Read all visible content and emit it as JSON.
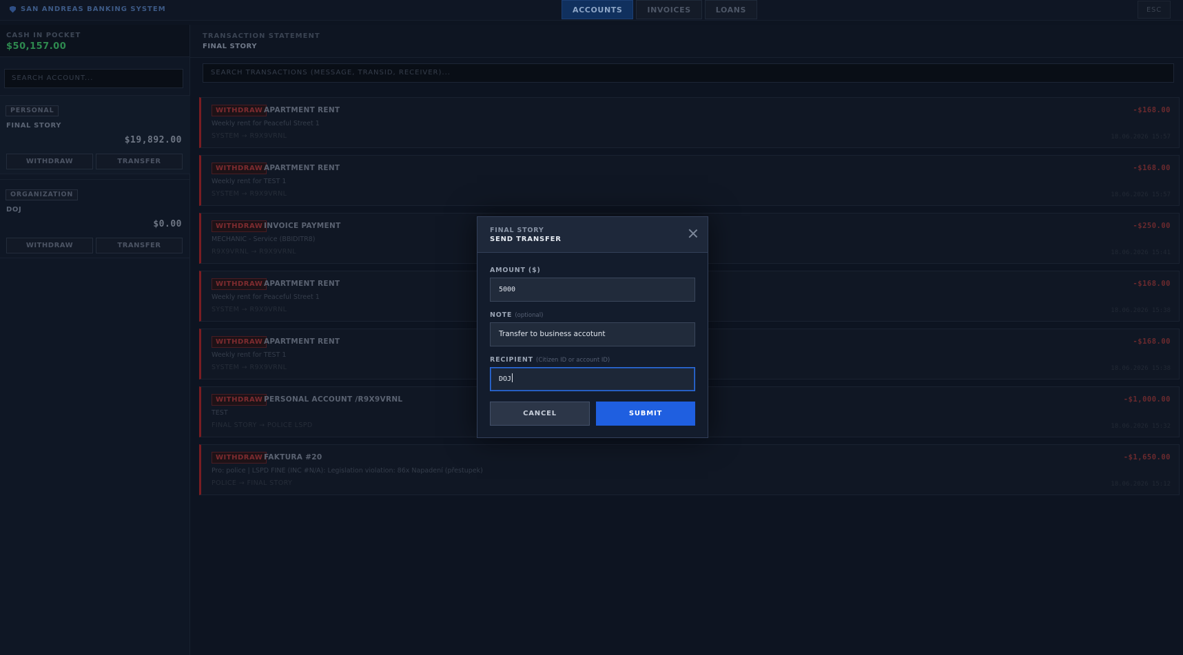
{
  "app": {
    "title": "SAN ANDREAS BANKING SYSTEM"
  },
  "nav": {
    "tabs": [
      {
        "label": "ACCOUNTS",
        "active": true
      },
      {
        "label": "INVOICES",
        "active": false
      },
      {
        "label": "LOANS",
        "active": false
      }
    ],
    "esc_label": "ESC"
  },
  "sidebar": {
    "cash_label": "CASH IN POCKET",
    "cash_value": "$50,157.00",
    "search_placeholder": "SEARCH ACCOUNT...",
    "accounts": [
      {
        "type": "PERSONAL",
        "name": "FINAL STORY",
        "balance": "$19,892.00",
        "withdraw_label": "WITHDRAW",
        "transfer_label": "TRANSFER"
      },
      {
        "type": "ORGANIZATION",
        "name": "DOJ",
        "balance": "$0.00",
        "withdraw_label": "WITHDRAW",
        "transfer_label": "TRANSFER"
      }
    ]
  },
  "statement": {
    "label": "TRANSACTION STATEMENT",
    "account_name": "FINAL STORY",
    "search_placeholder": "SEARCH TRANSACTIONS (MESSAGE, TRANSID, RECEIVER)...",
    "transactions": [
      {
        "type": "WITHDRAW",
        "title": "APARTMENT RENT",
        "description": "Weekly rent for Peaceful Street 1",
        "route": "SYSTEM → R9X9VRNL",
        "amount": "-$168.00",
        "date": "18.06.2026 15:57"
      },
      {
        "type": "WITHDRAW",
        "title": "APARTMENT RENT",
        "description": "Weekly rent for TEST 1",
        "route": "SYSTEM → R9X9VRNL",
        "amount": "-$168.00",
        "date": "18.06.2026 15:57"
      },
      {
        "type": "WITHDRAW",
        "title": "INVOICE PAYMENT",
        "description": "MECHANIC - Service (BBIDITR8)",
        "route": "R9X9VRNL → R9X9VRNL",
        "amount": "-$250.00",
        "date": "18.06.2026 15:41"
      },
      {
        "type": "WITHDRAW",
        "title": "APARTMENT RENT",
        "description": "Weekly rent for Peaceful Street 1",
        "route": "SYSTEM → R9X9VRNL",
        "amount": "-$168.00",
        "date": "18.06.2026 15:38"
      },
      {
        "type": "WITHDRAW",
        "title": "APARTMENT RENT",
        "description": "Weekly rent for TEST 1",
        "route": "SYSTEM → R9X9VRNL",
        "amount": "-$168.00",
        "date": "18.06.2026 15:38"
      },
      {
        "type": "WITHDRAW",
        "title": "PERSONAL ACCOUNT /R9X9VRNL",
        "description": "TEST",
        "route": "FINAL STORY → POLICE LSPD",
        "amount": "-$1,000.00",
        "date": "18.06.2026 15:32"
      },
      {
        "type": "WITHDRAW",
        "title": "FAKTURA #20",
        "description": "Pro: police | LSPD FINE (INC #N/A): Legislation violation: 86x Napadení (přestupek)",
        "route": "POLICE → FINAL STORY",
        "amount": "-$1,650.00",
        "date": "18.06.2026 15:12"
      }
    ]
  },
  "modal": {
    "subtitle": "FINAL STORY",
    "title": "SEND TRANSFER",
    "amount_label": "AMOUNT ($)",
    "amount_value": "5000",
    "note_label": "NOTE",
    "note_hint": "(optional)",
    "note_value": "Transfer to business accotunt",
    "recipient_label": "RECIPIENT",
    "recipient_hint": "(Citizen ID or account ID)",
    "recipient_value": "DOJ",
    "cancel_label": "CANCEL",
    "submit_label": "SUBMIT"
  }
}
